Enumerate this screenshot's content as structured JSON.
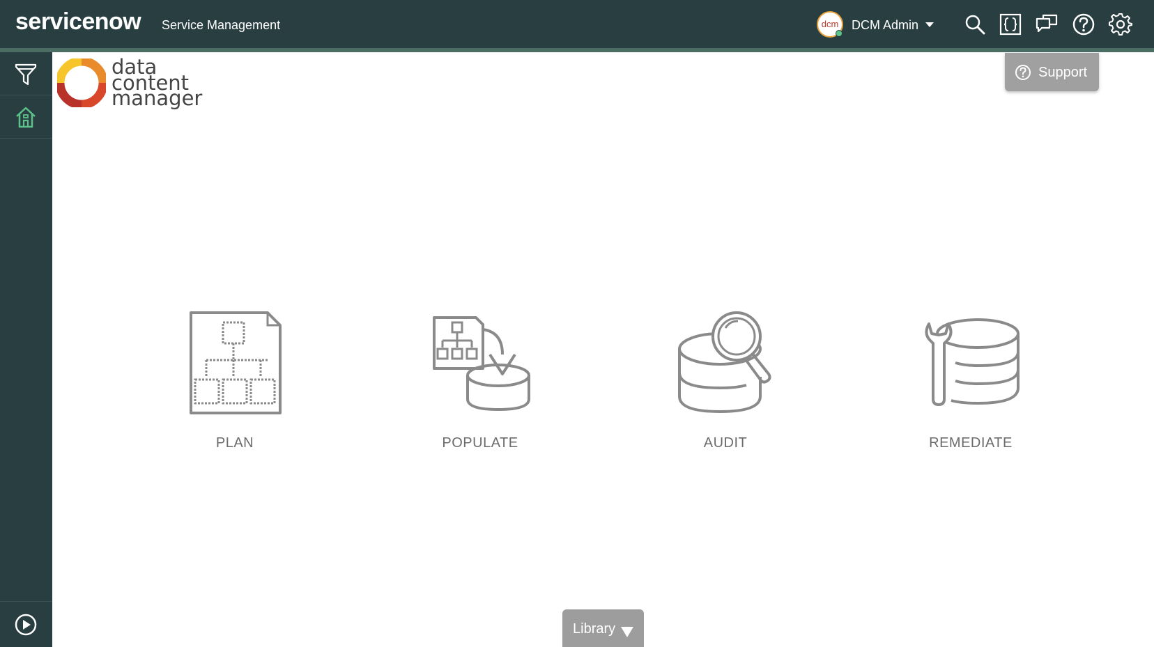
{
  "header": {
    "brand": "servicenow",
    "app_title": "Service Management",
    "user": {
      "avatar_text": "dcm",
      "name": "DCM Admin"
    },
    "icons": [
      "search-icon",
      "code-braces-icon",
      "chat-icon",
      "help-icon",
      "gear-icon"
    ]
  },
  "rail": {
    "items": [
      {
        "icon": "filter-icon"
      },
      {
        "icon": "home-icon"
      }
    ],
    "bottom_icon": "play-circle-icon"
  },
  "logo": {
    "line1": "data",
    "line2": "content",
    "line3": "manager"
  },
  "support": {
    "label": "Support"
  },
  "tiles": [
    {
      "label": "PLAN",
      "icon": "plan-document-icon"
    },
    {
      "label": "POPULATE",
      "icon": "populate-database-icon"
    },
    {
      "label": "AUDIT",
      "icon": "audit-database-icon"
    },
    {
      "label": "REMEDIATE",
      "icon": "remediate-database-icon"
    }
  ],
  "library": {
    "label": "Library"
  },
  "colors": {
    "header_bg": "#293e41",
    "accent": "#81b5a1",
    "icon_gray": "#8a8a8a",
    "button_gray": "#a0a0a0"
  }
}
